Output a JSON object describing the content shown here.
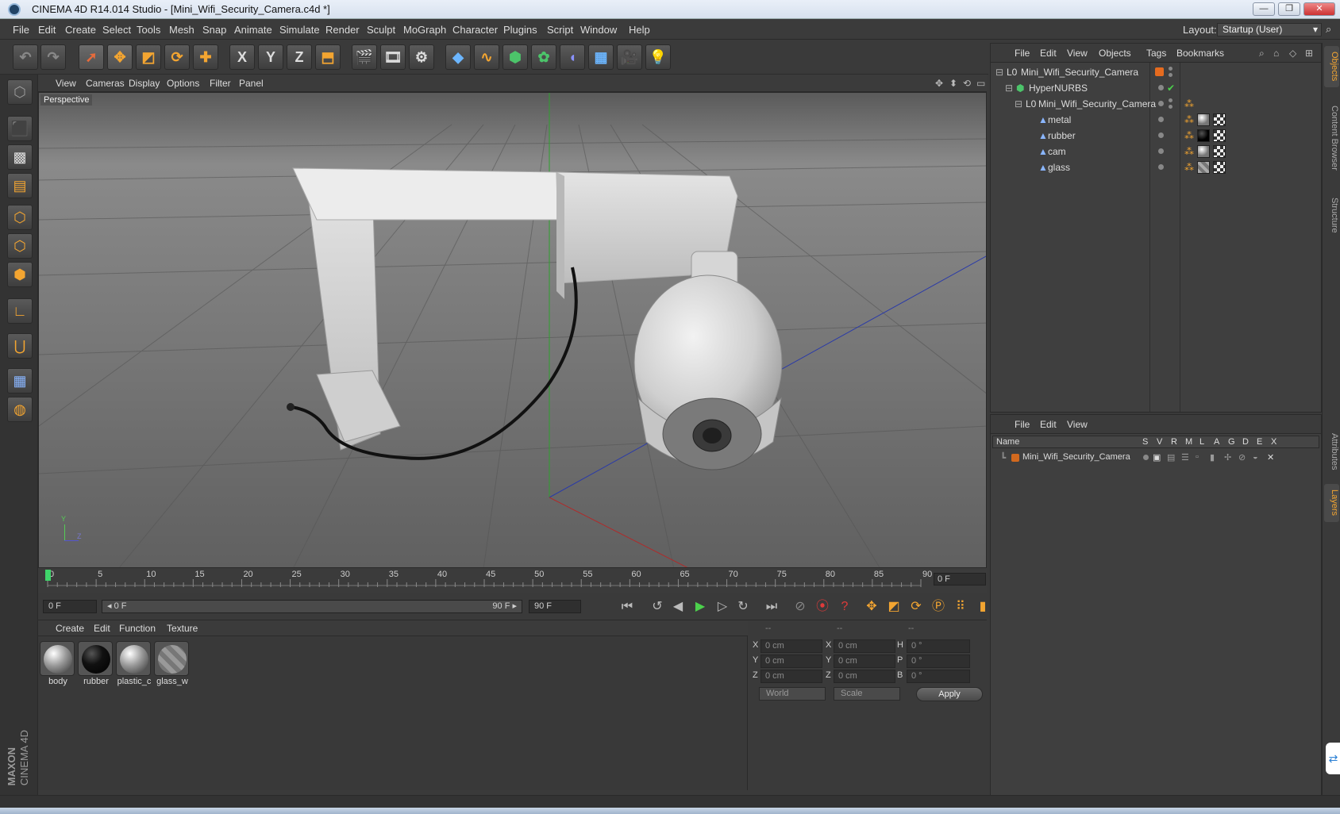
{
  "window": {
    "title": "CINEMA 4D R14.014 Studio - [Mini_Wifi_Security_Camera.c4d *]",
    "minimize": "—",
    "restore": "❐",
    "close": "✕"
  },
  "menubar": {
    "items": [
      "File",
      "Edit",
      "Create",
      "Select",
      "Tools",
      "Mesh",
      "Snap",
      "Animate",
      "Simulate",
      "Render",
      "Sculpt",
      "MoGraph",
      "Character",
      "Plugins",
      "Script",
      "Window",
      "Help"
    ],
    "layout_label": "Layout:",
    "layout_value": "Startup (User)"
  },
  "toolbar": {
    "icons": [
      "undo-icon",
      "redo-icon",
      "live-selection-icon",
      "move-icon",
      "scale-icon",
      "rotate-icon",
      "add-icon",
      "x-axis-icon",
      "y-axis-icon",
      "z-axis-icon",
      "coordinate-system-icon",
      "render-view-icon",
      "render-picture-viewer-icon",
      "render-settings-icon",
      "cube-icon",
      "spline-icon",
      "nurbs-icon",
      "array-icon",
      "deformer-icon",
      "floor-icon",
      "camera-icon",
      "light-icon"
    ],
    "axis_labels": [
      "X",
      "Y",
      "Z"
    ]
  },
  "viewport": {
    "menu": [
      "View",
      "Cameras",
      "Display",
      "Options",
      "Filter",
      "Panel"
    ],
    "label": "Perspective",
    "axis": {
      "y": "Y",
      "z": "Z"
    }
  },
  "timeline": {
    "ticks": [
      "0",
      "5",
      "10",
      "15",
      "20",
      "25",
      "30",
      "35",
      "40",
      "45",
      "50",
      "55",
      "60",
      "65",
      "70",
      "75",
      "80",
      "85",
      "90"
    ],
    "current_frame": "0 F"
  },
  "transport": {
    "start_field": "0 F",
    "slider_left": "◂ 0 F",
    "slider_right": "90 F ▸",
    "end_field": "90 F"
  },
  "material_manager": {
    "menu": [
      "Create",
      "Edit",
      "Function",
      "Texture"
    ],
    "materials": [
      {
        "name": "body",
        "style": "chrome"
      },
      {
        "name": "rubber",
        "style": "black"
      },
      {
        "name": "plastic_c",
        "style": "chrome"
      },
      {
        "name": "glass_w",
        "style": "glass"
      }
    ]
  },
  "coordinates": {
    "headers": [
      "--",
      "--",
      "--"
    ],
    "rows": [
      {
        "l1": "X",
        "v1": "0 cm",
        "l2": "X",
        "v2": "0 cm",
        "l3": "H",
        "v3": "0 °"
      },
      {
        "l1": "Y",
        "v1": "0 cm",
        "l2": "Y",
        "v2": "0 cm",
        "l3": "P",
        "v3": "0 °"
      },
      {
        "l1": "Z",
        "v1": "0 cm",
        "l2": "Z",
        "v2": "0 cm",
        "l3": "B",
        "v3": "0 °"
      }
    ],
    "world": "World",
    "scale": "Scale",
    "apply": "Apply"
  },
  "objects_panel": {
    "menu": [
      "File",
      "Edit",
      "View",
      "Objects",
      "Tags",
      "Bookmarks"
    ],
    "rows": [
      {
        "name": "Mini_Wifi_Security_Camera",
        "indent": 0,
        "icon": "null-icon"
      },
      {
        "name": "HyperNURBS",
        "indent": 1,
        "icon": "hypernurbs-icon"
      },
      {
        "name": "Mini_Wifi_Security_Camera",
        "indent": 2,
        "icon": "null-icon"
      },
      {
        "name": "metal",
        "indent": 3,
        "icon": "polygon-object-icon"
      },
      {
        "name": "rubber",
        "indent": 3,
        "icon": "polygon-object-icon"
      },
      {
        "name": "cam",
        "indent": 3,
        "icon": "polygon-object-icon"
      },
      {
        "name": "glass",
        "indent": 3,
        "icon": "polygon-object-icon"
      }
    ]
  },
  "layers_panel": {
    "menu": [
      "File",
      "Edit",
      "View"
    ],
    "columns": [
      "Name",
      "S",
      "V",
      "R",
      "M",
      "L",
      "A",
      "G",
      "D",
      "E",
      "X"
    ],
    "rows": [
      {
        "name": "Mini_Wifi_Security_Camera",
        "color": "#d2691e"
      }
    ]
  },
  "side_tabs": [
    "Objects",
    "Content Browser",
    "Structure",
    "Attributes",
    "Layers"
  ],
  "branding": {
    "line1": "MAXON",
    "line2": "CINEMA 4D"
  },
  "colors": {
    "accent": "#f3a531",
    "bg": "#3a3a3a",
    "viewport": "#6c6c6c"
  }
}
